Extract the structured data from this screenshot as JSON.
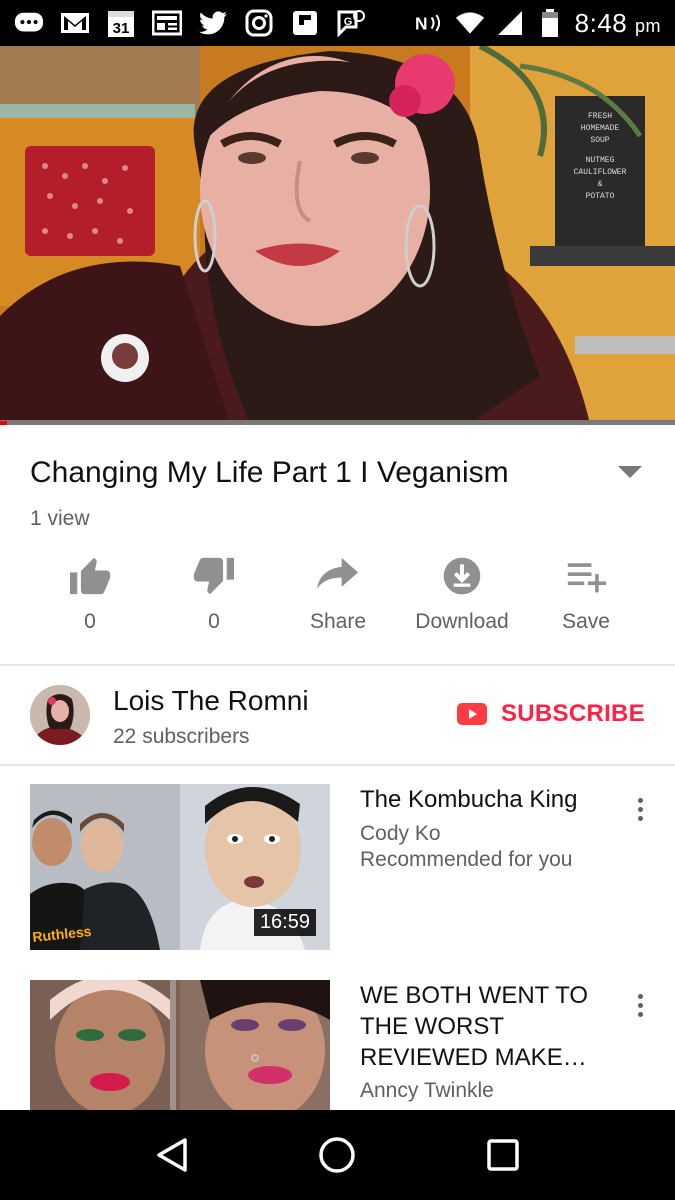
{
  "status_bar": {
    "calendar_day": "31",
    "time": "8:48",
    "ampm": "pm",
    "icons": [
      "chat-icon",
      "gmail-icon",
      "calendar-icon",
      "news-icon",
      "twitter-icon",
      "instagram-icon",
      "flipboard-icon",
      "google-voice-icon",
      "nfc-icon",
      "wifi-icon",
      "signal-icon",
      "battery-icon"
    ]
  },
  "video": {
    "progress_fraction": 0.01,
    "menu_board": [
      "FRESH",
      "HOMEMADE",
      "SOUP",
      "NUTMEG",
      "CAULIFLOWER",
      "&",
      "POTATO"
    ]
  },
  "title": "Changing My Life Part 1 I Veganism",
  "views": "1 view",
  "actions": {
    "like_count": "0",
    "dislike_count": "0",
    "share_label": "Share",
    "download_label": "Download",
    "save_label": "Save"
  },
  "channel": {
    "name": "Lois The Romni",
    "subscribers": "22 subscribers",
    "subscribe_label": "SUBSCRIBE"
  },
  "recommendations": [
    {
      "title": "The Kombucha King",
      "channel": "Cody Ko",
      "reason": "Recommended for you",
      "duration": "16:59",
      "thumb_text": "Ruthless"
    },
    {
      "title": "WE BOTH WENT TO THE WORST REVIEWED MAKE…",
      "channel": "Anncy Twinkle",
      "reason": "",
      "duration": ""
    }
  ],
  "colors": {
    "accent": "#ff2a44",
    "subscribe": "#ff3b44",
    "secondary_text": "#606060"
  }
}
